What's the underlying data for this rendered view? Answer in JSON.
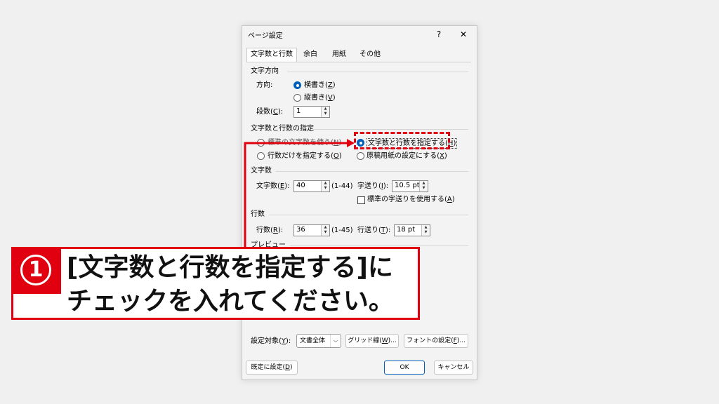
{
  "dialog": {
    "title": "ページ設定",
    "help": "?",
    "close": "✕",
    "tabs": [
      "文字数と行数",
      "余白",
      "用紙",
      "その他"
    ],
    "direction": {
      "header": "文字方向",
      "label": "方向:",
      "horizontal_text": "横書き",
      "horizontal_key": "Z",
      "vertical_text": "縦書き",
      "vertical_key": "V",
      "columns_text": "段数",
      "columns_key": "C",
      "columns_value": "1"
    },
    "grid": {
      "header": "文字数と行数の指定",
      "opt1_text": "標準の文字数を使う",
      "opt1_key": "N",
      "opt2_text": "文字数と行数を指定する",
      "opt2_key": "H",
      "opt3_text": "行数だけを指定する",
      "opt3_key": "O",
      "opt4_text": "原稿用紙の設定にする",
      "opt4_key": "X"
    },
    "chars": {
      "header": "文字数",
      "label_text": "文字数",
      "label_key": "E",
      "value": "40",
      "range": "(1-44)",
      "pitch_text": "字送り",
      "pitch_key": "I",
      "pitch_value": "10.5 pt",
      "std_text": "標準の字送りを使用する",
      "std_key": "A"
    },
    "lines": {
      "header": "行数",
      "label_text": "行数",
      "label_key": "R",
      "value": "36",
      "range": "(1-45)",
      "pitch_text": "行送り",
      "pitch_key": "T",
      "pitch_value": "18 pt"
    },
    "preview": {
      "header": "プレビュー"
    },
    "bottom": {
      "apply_text": "設定対象",
      "apply_key": "Y",
      "apply_value": "文書全体",
      "grid_text": "グリッド線",
      "grid_key": "W",
      "font_text": "フォントの設定",
      "font_key": "F",
      "ellipsis": "...",
      "default_text": "既定に設定",
      "default_key": "D",
      "ok": "OK",
      "cancel": "キャンセル"
    }
  },
  "annotation": {
    "number": "1",
    "line1": "[文字数と行数を指定する]に",
    "line2": "チェックを入れてください。",
    "color": "#e0000f"
  }
}
